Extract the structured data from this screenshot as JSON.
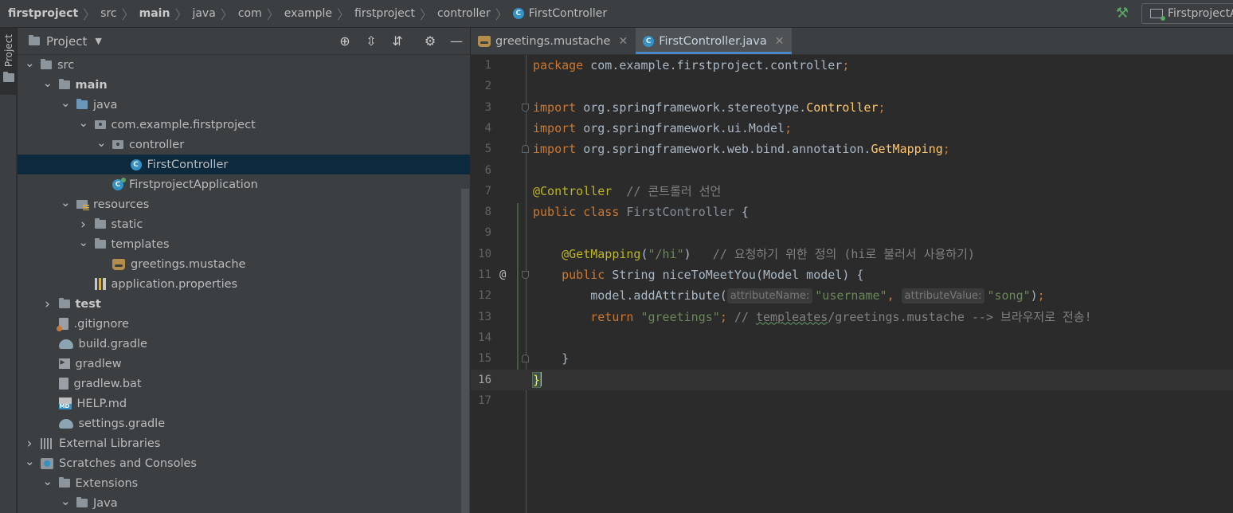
{
  "breadcrumb": {
    "items": [
      "firstproject",
      "src",
      "main",
      "java",
      "com",
      "example",
      "firstproject",
      "controller",
      "FirstController"
    ]
  },
  "toolbar": {
    "run_config_label": "FirstprojectA"
  },
  "tool_strip": {
    "project_tab_label": "Project"
  },
  "project_panel": {
    "title": "Project",
    "tree": [
      {
        "label": "src",
        "depth": 1,
        "expand": "open",
        "icon": "folder-icon",
        "bold": false
      },
      {
        "label": "main",
        "depth": 2,
        "expand": "open",
        "icon": "folder-icon",
        "bold": true
      },
      {
        "label": "java",
        "depth": 3,
        "expand": "open",
        "icon": "source-folder-icon",
        "bold": false
      },
      {
        "label": "com.example.firstproject",
        "depth": 4,
        "expand": "open",
        "icon": "package-icon",
        "bold": false
      },
      {
        "label": "controller",
        "depth": 5,
        "expand": "open",
        "icon": "package-icon",
        "bold": false
      },
      {
        "label": "FirstController",
        "depth": 6,
        "expand": "none",
        "icon": "class-icon",
        "bold": false,
        "selected": true
      },
      {
        "label": "FirstprojectApplication",
        "depth": 5,
        "expand": "none",
        "icon": "spring-class-icon",
        "bold": false
      },
      {
        "label": "resources",
        "depth": 3,
        "expand": "open",
        "icon": "resources-folder-icon",
        "bold": false
      },
      {
        "label": "static",
        "depth": 4,
        "expand": "closed",
        "icon": "folder-icon",
        "bold": false
      },
      {
        "label": "templates",
        "depth": 4,
        "expand": "open",
        "icon": "folder-icon",
        "bold": false
      },
      {
        "label": "greetings.mustache",
        "depth": 5,
        "expand": "none",
        "icon": "mustache-icon",
        "bold": false
      },
      {
        "label": "application.properties",
        "depth": 4,
        "expand": "none",
        "icon": "properties-icon",
        "bold": false
      },
      {
        "label": "test",
        "depth": 2,
        "expand": "closed",
        "icon": "folder-icon",
        "bold": true
      },
      {
        "label": ".gitignore",
        "depth": 2,
        "expand": "none",
        "icon": "gitignore-icon",
        "bold": false
      },
      {
        "label": "build.gradle",
        "depth": 2,
        "expand": "none",
        "icon": "gradle-icon",
        "bold": false
      },
      {
        "label": "gradlew",
        "depth": 2,
        "expand": "none",
        "icon": "terminal-icon",
        "bold": false
      },
      {
        "label": "gradlew.bat",
        "depth": 2,
        "expand": "none",
        "icon": "bat-file-icon",
        "bold": false
      },
      {
        "label": "HELP.md",
        "depth": 2,
        "expand": "none",
        "icon": "markdown-icon",
        "bold": false
      },
      {
        "label": "settings.gradle",
        "depth": 2,
        "expand": "none",
        "icon": "gradle-icon",
        "bold": false
      },
      {
        "label": "External Libraries",
        "depth": 1,
        "expand": "closed",
        "icon": "libraries-icon",
        "bold": false
      },
      {
        "label": "Scratches and Consoles",
        "depth": 1,
        "expand": "open",
        "icon": "scratches-icon",
        "bold": false
      },
      {
        "label": "Extensions",
        "depth": 2,
        "expand": "open",
        "icon": "folder-icon",
        "bold": false
      },
      {
        "label": "Java",
        "depth": 3,
        "expand": "open",
        "icon": "folder-icon",
        "bold": false
      }
    ]
  },
  "editor": {
    "tabs": [
      {
        "label": "greetings.mustache",
        "active": false,
        "icon": "mustache-icon"
      },
      {
        "label": "FirstController.java",
        "active": true,
        "icon": "class-icon"
      }
    ],
    "current_line": 16,
    "lines": [
      {
        "n": "1",
        "tokens": [
          [
            "kw",
            "package "
          ],
          [
            "pl",
            "com.example.firstproject.controller"
          ],
          [
            "kw",
            ";"
          ]
        ]
      },
      {
        "n": "2",
        "tokens": []
      },
      {
        "n": "3",
        "fold": "down",
        "tokens": [
          [
            "kw",
            "import "
          ],
          [
            "pl",
            "org.springframework.stereotype."
          ],
          [
            "fn",
            "Controller"
          ],
          [
            "kw",
            ";"
          ]
        ]
      },
      {
        "n": "4",
        "tokens": [
          [
            "kw",
            "import "
          ],
          [
            "pl",
            "org.springframework.ui.Model"
          ],
          [
            "kw",
            ";"
          ]
        ]
      },
      {
        "n": "5",
        "fold": "up",
        "tokens": [
          [
            "kw",
            "import "
          ],
          [
            "pl",
            "org.springframework.web.bind.annotation."
          ],
          [
            "fn",
            "GetMapping"
          ],
          [
            "kw",
            ";"
          ]
        ]
      },
      {
        "n": "6",
        "tokens": []
      },
      {
        "n": "7",
        "tokens": [
          [
            "ann",
            "@Controller"
          ],
          [
            "pl",
            "  "
          ],
          [
            "cmt",
            "// 콘트롤러 선언"
          ]
        ]
      },
      {
        "n": "8",
        "tokens": [
          [
            "kw",
            "public class "
          ],
          [
            "cd",
            "FirstController "
          ],
          [
            "br",
            "{"
          ]
        ]
      },
      {
        "n": "9",
        "tokens": []
      },
      {
        "n": "10",
        "tokens": [
          [
            "pl",
            "    "
          ],
          [
            "ann",
            "@GetMapping"
          ],
          [
            "pl",
            "("
          ],
          [
            "str",
            "\"/hi\""
          ],
          [
            "pl",
            ")   "
          ],
          [
            "cmt",
            "// 요청하기 위한 정의 (hi로 불러서 사용하기)"
          ]
        ]
      },
      {
        "n": "11",
        "mark": "@",
        "fold": "down",
        "tokens": [
          [
            "pl",
            "    "
          ],
          [
            "kw",
            "public "
          ],
          [
            "pl",
            "String "
          ],
          [
            "fn2",
            "niceToMeetYou"
          ],
          [
            "pl",
            "(Model model) {"
          ]
        ]
      },
      {
        "n": "12",
        "tokens": [
          [
            "pl",
            "        model.addAttribute("
          ],
          [
            "hint",
            "attributeName:"
          ],
          [
            "str",
            "\"username\""
          ],
          [
            "kw",
            ", "
          ],
          [
            "hint",
            "attributeValue:"
          ],
          [
            "str",
            "\"song\""
          ],
          [
            "pl",
            ")"
          ],
          [
            "kw",
            ";"
          ]
        ]
      },
      {
        "n": "13",
        "tokens": [
          [
            "pl",
            "        "
          ],
          [
            "kw",
            "return "
          ],
          [
            "str",
            "\"greetings\""
          ],
          [
            "kw",
            "; "
          ],
          [
            "cmt",
            "// "
          ],
          [
            "typo",
            "templeates"
          ],
          [
            "cmt",
            "/greetings.mustache --> 브라우저로 전송!"
          ]
        ]
      },
      {
        "n": "14",
        "tokens": []
      },
      {
        "n": "15",
        "fold": "up",
        "tokens": [
          [
            "pl",
            "    }"
          ]
        ]
      },
      {
        "n": "16",
        "tokens": [
          [
            "brc",
            "}"
          ],
          [
            "caret",
            ""
          ]
        ]
      },
      {
        "n": "17",
        "tokens": []
      }
    ]
  },
  "colors": {
    "keyword": "#cc7832",
    "annotation": "#bbb529",
    "string": "#6a8759",
    "comment": "#808080",
    "method_decl": "#ffc66d",
    "selection": "#0d293e",
    "accent": "#4a88c7"
  }
}
